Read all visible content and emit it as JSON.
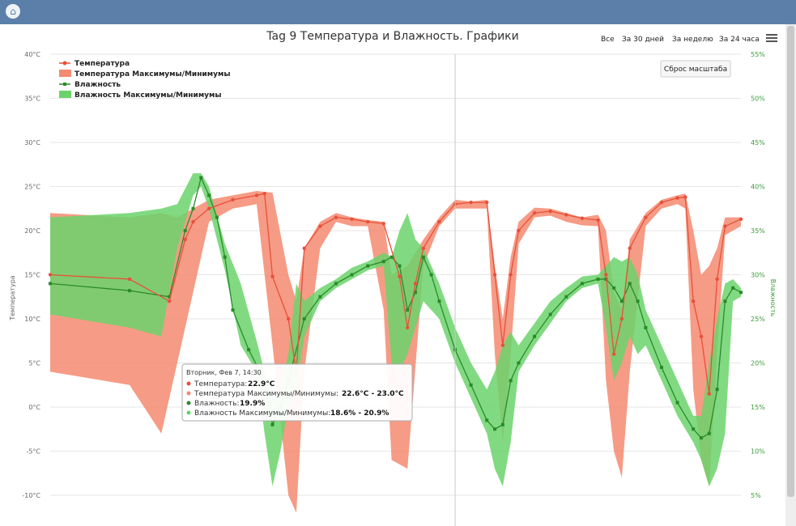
{
  "window": {
    "home_icon": "home-icon",
    "accent": "#5b7fa9"
  },
  "range_buttons": [
    "Все",
    "За 30 дней",
    "За неделю",
    "За 24 часа"
  ],
  "menu_icon": "hamburger-menu-icon",
  "reset_zoom_label": "Сброс масштаба",
  "tooltip": {
    "title": "Вторник, Фев 7, 14:30",
    "rows": [
      {
        "label": "Температура:",
        "value": "22.9°C",
        "color": "#e8503a"
      },
      {
        "label": "Температура Максимумы/Минимумы:",
        "value": "22.6°C - 23.0°C",
        "color": "#f48a70"
      },
      {
        "label": "Влажность:",
        "value": "19.9%",
        "color": "#2a8a2a"
      },
      {
        "label": "Влажность Максимумы/Минимумы:",
        "value": "18.6% - 20.9%",
        "color": "#6bd36b"
      }
    ]
  },
  "chart_data": {
    "type": "line",
    "title": "Tag 9 Температура и Влажность. Графики",
    "ylabel": "Температура",
    "y2label": "Влажность",
    "ylim": [
      -10,
      40
    ],
    "y2lim": [
      5,
      55
    ],
    "yticks": [
      "40°C",
      "35°C",
      "30°C",
      "25°C",
      "20°C",
      "15°C",
      "10°C",
      "5°C",
      "0°C",
      "-5°C",
      "-10°C"
    ],
    "y2ticks": [
      "55%",
      "50%",
      "45%",
      "40%",
      "35%",
      "30%",
      "25%",
      "20%",
      "15%",
      "10%",
      "5%"
    ],
    "grid": true,
    "legend_position": "top-left",
    "colors": {
      "temperature": "#e8503a",
      "temperature_range": "#f48a70",
      "humidity": "#2a8a2a",
      "humidity_range": "#6bd36b"
    },
    "series": [
      {
        "name": "Температура",
        "values": [
          [
            0,
            15
          ],
          [
            10,
            14.5
          ],
          [
            15,
            12
          ],
          [
            17,
            19
          ],
          [
            18,
            21
          ],
          [
            20,
            22.5
          ],
          [
            23,
            23.5
          ],
          [
            26,
            24
          ],
          [
            27,
            24.2
          ],
          [
            28,
            14.8
          ],
          [
            30,
            10
          ],
          [
            31,
            4
          ],
          [
            32,
            18
          ],
          [
            34,
            20.5
          ],
          [
            36,
            21.5
          ],
          [
            38,
            21.3
          ],
          [
            40,
            21
          ],
          [
            42,
            20.8
          ],
          [
            44,
            14.8
          ],
          [
            45,
            9
          ],
          [
            46,
            14
          ],
          [
            47,
            18
          ],
          [
            49,
            21
          ],
          [
            51,
            23
          ],
          [
            53,
            23.2
          ],
          [
            55,
            23.2
          ],
          [
            56,
            15
          ],
          [
            57,
            7
          ],
          [
            58,
            15
          ],
          [
            59,
            20
          ],
          [
            61,
            22
          ],
          [
            63,
            22.2
          ],
          [
            65,
            21.8
          ],
          [
            67,
            21.4
          ],
          [
            69,
            21.2
          ],
          [
            70,
            15
          ],
          [
            71,
            6
          ],
          [
            72,
            10
          ],
          [
            73,
            18
          ],
          [
            75,
            21.5
          ],
          [
            77,
            23.2
          ],
          [
            79,
            23.7
          ],
          [
            80,
            23.8
          ],
          [
            81,
            12
          ],
          [
            82,
            8
          ],
          [
            83,
            1.5
          ],
          [
            84,
            14.5
          ],
          [
            85,
            20.5
          ],
          [
            87,
            21.3
          ]
        ]
      },
      {
        "name": "Температура Максимумы/Минимумы",
        "values": [
          [
            0,
            4,
            22
          ],
          [
            10,
            2.5,
            21.5
          ],
          [
            14,
            -3,
            22
          ],
          [
            16,
            5,
            21.5
          ],
          [
            18,
            13,
            22.5
          ],
          [
            20,
            21,
            23.5
          ],
          [
            23,
            22.5,
            24
          ],
          [
            26,
            23,
            24.5
          ],
          [
            28,
            7,
            24.3
          ],
          [
            30,
            -10,
            15
          ],
          [
            31,
            -12,
            12
          ],
          [
            32,
            4,
            18
          ],
          [
            34,
            18,
            21
          ],
          [
            36,
            21,
            22
          ],
          [
            38,
            20.5,
            21.5
          ],
          [
            40,
            20.5,
            21.2
          ],
          [
            42,
            11,
            21
          ],
          [
            43,
            -6,
            15
          ],
          [
            45,
            -7,
            16
          ],
          [
            47,
            16,
            19
          ],
          [
            49,
            20.5,
            21.5
          ],
          [
            51,
            22.5,
            23.5
          ],
          [
            53,
            22.5,
            23.3
          ],
          [
            55,
            22.5,
            23.5
          ],
          [
            56,
            6,
            16
          ],
          [
            57,
            -4,
            10
          ],
          [
            58,
            6,
            17
          ],
          [
            59,
            18.5,
            21
          ],
          [
            61,
            21.5,
            22.6
          ],
          [
            63,
            21.7,
            22.5
          ],
          [
            65,
            21,
            22
          ],
          [
            67,
            20.6,
            21.5
          ],
          [
            69,
            20.5,
            21.8
          ],
          [
            70,
            3,
            20
          ],
          [
            71,
            -5,
            13
          ],
          [
            72,
            -8,
            11
          ],
          [
            73,
            4,
            19
          ],
          [
            75,
            20.5,
            22
          ],
          [
            77,
            22.5,
            23.5
          ],
          [
            79,
            23,
            24
          ],
          [
            80,
            22.5,
            24.2
          ],
          [
            81,
            2,
            20
          ],
          [
            82,
            -6,
            15
          ],
          [
            83,
            -9,
            16
          ],
          [
            84,
            6,
            18
          ],
          [
            85,
            19.5,
            21.5
          ],
          [
            87,
            20.5,
            21.5
          ]
        ]
      },
      {
        "name": "Влажность",
        "values": [
          [
            0,
            29
          ],
          [
            10,
            28.2
          ],
          [
            15,
            27.5
          ],
          [
            17,
            35
          ],
          [
            18,
            37.5
          ],
          [
            19,
            41
          ],
          [
            20,
            39
          ],
          [
            21,
            36.5
          ],
          [
            22,
            32
          ],
          [
            23,
            26
          ],
          [
            25,
            21.5
          ],
          [
            27,
            18
          ],
          [
            28,
            13
          ],
          [
            29,
            15
          ],
          [
            30,
            18
          ],
          [
            32,
            25
          ],
          [
            34,
            27.5
          ],
          [
            36,
            29
          ],
          [
            38,
            30
          ],
          [
            40,
            31
          ],
          [
            42,
            31.5
          ],
          [
            43,
            32
          ],
          [
            44,
            31
          ],
          [
            45,
            26
          ],
          [
            46,
            28
          ],
          [
            47,
            32
          ],
          [
            48,
            30
          ],
          [
            49,
            27
          ],
          [
            51,
            21.5
          ],
          [
            53,
            17.5
          ],
          [
            55,
            13.5
          ],
          [
            56,
            12.5
          ],
          [
            57,
            13
          ],
          [
            58,
            18
          ],
          [
            59,
            20
          ],
          [
            61,
            23
          ],
          [
            63,
            25.5
          ],
          [
            65,
            27.5
          ],
          [
            67,
            29
          ],
          [
            69,
            29.5
          ],
          [
            70,
            29.5
          ],
          [
            71,
            28.5
          ],
          [
            72,
            27
          ],
          [
            73,
            29
          ],
          [
            74,
            27
          ],
          [
            75,
            24
          ],
          [
            77,
            19.5
          ],
          [
            79,
            15.5
          ],
          [
            81,
            12.5
          ],
          [
            82,
            11.5
          ],
          [
            83,
            12
          ],
          [
            84,
            17
          ],
          [
            85,
            27
          ],
          [
            86,
            28.5
          ],
          [
            87,
            28
          ]
        ]
      },
      {
        "name": "Влажность Максимумы/Минимумы",
        "values": [
          [
            0,
            25.5,
            36.5
          ],
          [
            10,
            24,
            37
          ],
          [
            14,
            23,
            37.5
          ],
          [
            16,
            33,
            38
          ],
          [
            18,
            39,
            41.5
          ],
          [
            19,
            40,
            41.5
          ],
          [
            20,
            37.5,
            40
          ],
          [
            22,
            30.5,
            33.5
          ],
          [
            24,
            22,
            29
          ],
          [
            26,
            19,
            22.5
          ],
          [
            27,
            12,
            19
          ],
          [
            28,
            6,
            16
          ],
          [
            29,
            10,
            17
          ],
          [
            30,
            15,
            21
          ],
          [
            31,
            17,
            29
          ],
          [
            32,
            23,
            27
          ],
          [
            34,
            27,
            28.5
          ],
          [
            36,
            28.5,
            29.5
          ],
          [
            38,
            29.5,
            30.8
          ],
          [
            40,
            30.5,
            31.5
          ],
          [
            42,
            31,
            32.5
          ],
          [
            43,
            20,
            32
          ],
          [
            44,
            19,
            35
          ],
          [
            45,
            21,
            37
          ],
          [
            46,
            24,
            34
          ],
          [
            47,
            27,
            33
          ],
          [
            49,
            25,
            29
          ],
          [
            51,
            20,
            24
          ],
          [
            53,
            16,
            20
          ],
          [
            55,
            12,
            17
          ],
          [
            56,
            8,
            19
          ],
          [
            57,
            6,
            22
          ],
          [
            58,
            11,
            23.5
          ],
          [
            59,
            19,
            22
          ],
          [
            61,
            22,
            24.5
          ],
          [
            63,
            24.5,
            27
          ],
          [
            65,
            27,
            28.5
          ],
          [
            67,
            28.5,
            29.8
          ],
          [
            69,
            29,
            30
          ],
          [
            70,
            24,
            31
          ],
          [
            71,
            18,
            32
          ],
          [
            72,
            20,
            31.5
          ],
          [
            73,
            23,
            32
          ],
          [
            74,
            21,
            30
          ],
          [
            75,
            22,
            26
          ],
          [
            77,
            18,
            22
          ],
          [
            79,
            14,
            18
          ],
          [
            81,
            11,
            14
          ],
          [
            82,
            9,
            14
          ],
          [
            83,
            6,
            20
          ],
          [
            84,
            8,
            25
          ],
          [
            85,
            12,
            29
          ],
          [
            86,
            27,
            29.5
          ],
          [
            87,
            27.5,
            28.5
          ]
        ]
      }
    ],
    "x_domain": [
      0,
      87
    ],
    "crosshair_x": 51,
    "tooltip_x": 51
  }
}
